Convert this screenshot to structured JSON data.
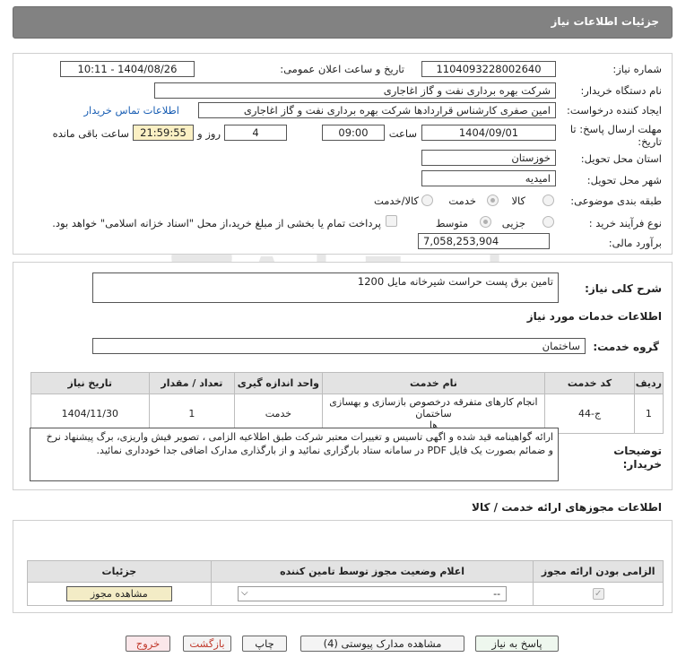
{
  "header": {
    "title": "جزئیات اطلاعات نیاز"
  },
  "watermark": {
    "text": "AriaTender.neT"
  },
  "form": {
    "need_number_label": "شماره نیاز:",
    "need_number": "1104093228002640",
    "announce_label": "تاریخ و ساعت اعلان عمومی:",
    "announce_value": "1404/08/26 - 10:11",
    "buyer_label": "نام دستگاه خریدار:",
    "buyer_value": "شرکت بهره برداری نفت و گاز اغاجاری",
    "creator_label": "ایجاد کننده درخواست:",
    "creator_value": "امین صفری کارشناس قراردادها شرکت بهره برداری نفت و گاز اغاجاری",
    "contact_link": "اطلاعات تماس خریدار",
    "deadline_label_1": "مهلت ارسال پاسخ: تا",
    "deadline_label_2": "تاریخ:",
    "deadline_date": "1404/09/01",
    "time_label": "ساعت",
    "deadline_time": "09:00",
    "days_value": "4",
    "days_label": "روز و",
    "remaining_time": "21:59:55",
    "remaining_label": "ساعت باقی مانده",
    "province_label": "استان محل تحویل:",
    "province_value": "خوزستان",
    "city_label": "شهر محل تحویل:",
    "city_value": "امیدیه",
    "category_label": "طبقه بندی موضوعی:",
    "category_options": [
      "کالا",
      "خدمت",
      "کالا/خدمت"
    ],
    "process_label": "نوع فرآیند خرید :",
    "process_options": [
      "جزیی",
      "متوسط"
    ],
    "payment_note": "پرداخت تمام یا بخشی از مبلغ خرید،از محل \"اسناد خزانه اسلامی\" خواهد بود.",
    "estimate_label": "برآورد مالی:",
    "estimate_value": "7,058,253,904"
  },
  "summary": {
    "label": "شرح کلی نیاز:",
    "value": "تامین برق پست حراست شیرخانه مایل 1200"
  },
  "services": {
    "section_title": "اطلاعات خدمات مورد نیاز",
    "group_label": "گروه خدمت:",
    "group_value": "ساختمان",
    "columns": [
      "ردیف",
      "کد خدمت",
      "نام خدمت",
      "واحد اندازه گیری",
      "تعداد / مقدار",
      "تاریخ نیاز"
    ],
    "rows": [
      {
        "row": "1",
        "code": "ج-44",
        "name_1": "انجام کارهای متفرقه درخصوص بازسازی و بهسازی ساختمان",
        "name_2": "ها",
        "unit": "خدمت",
        "qty": "1",
        "date": "1404/11/30"
      }
    ]
  },
  "buyer_notes": {
    "label_1": "توضیحات",
    "label_2": "خریدار:",
    "line_1": "ارائه گواهینامه قید شده و اگهی تاسیس و تغییرات معتبر شرکت طبق اطلاعیه الزامی ، تصویر فیش واریزی، برگ پیشنهاد نرخ",
    "line_2": "و ضمائم بصورت یک فایل PDF در سامانه ستاد بارگزاری نمائید و از بارگذاری مدارک اضافی جدا خودداری نمائید."
  },
  "permits": {
    "section_title": "اطلاعات مجوزهای ارائه خدمت / کالا",
    "columns": [
      "الزامی بودن ارائه مجوز",
      "اعلام وضعیت مجوز توسط تامین کننده",
      "جزئیات"
    ],
    "select_value": "--",
    "view_button": "مشاهده مجوز"
  },
  "buttons": {
    "reply": "پاسخ به نیاز",
    "attachments": "مشاهده مدارک پیوستی (4)",
    "print": "چاپ",
    "back": "بازگشت",
    "exit": "خروج"
  },
  "colors": {
    "header_bg": "#828282",
    "link": "#1a5fb4",
    "remaining_bg": "#fbf0c4",
    "permit_button_bg": "#f3ecc6",
    "back_text": "#c0392b",
    "exit_bg": "#fbe7ea",
    "reply_bg": "#eef7ee"
  }
}
